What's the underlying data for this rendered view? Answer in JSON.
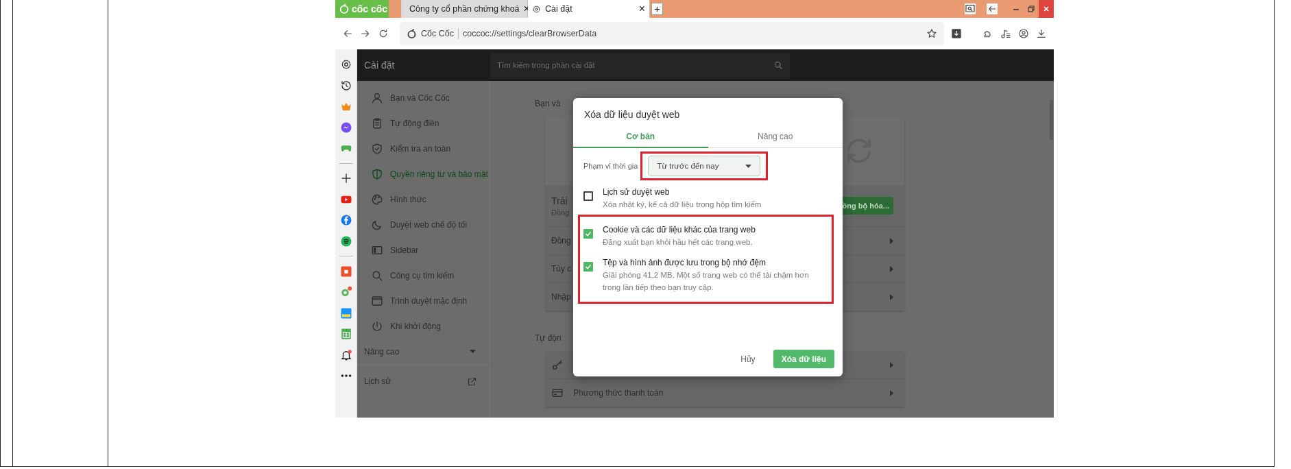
{
  "browser": {
    "tab_strip": {
      "logo": "cốc cốc",
      "new_tab": "+",
      "tabs": [
        {
          "title": "Công ty cổ phần chứng khoá",
          "close": "×",
          "selected": false
        },
        {
          "title": "Cài đặt",
          "close": "×",
          "selected": true
        }
      ]
    },
    "toolbar": {
      "site_name": "Cốc Cốc",
      "url": "coccoc://settings/clearBrowserData"
    },
    "settings": {
      "header_title": "Cài đặt",
      "search_placeholder": "Tìm kiếm trong phần cài đặt",
      "sidebar": {
        "items": [
          {
            "label": "Bạn và Cốc Cốc",
            "selected": false
          },
          {
            "label": "Tự động điền",
            "selected": false
          },
          {
            "label": "Kiểm tra an toàn",
            "selected": false
          },
          {
            "label": "Quyền riêng tư và bảo mật",
            "selected": true
          },
          {
            "label": "Hình thức",
            "selected": false
          },
          {
            "label": "Duyệt web chế độ tối",
            "selected": false
          },
          {
            "label": "Sidebar",
            "selected": false
          },
          {
            "label": "Công cụ tìm kiếm",
            "selected": false
          },
          {
            "label": "Trình duyệt mặc định",
            "selected": false
          },
          {
            "label": "Khi khởi động",
            "selected": false
          }
        ],
        "advanced": "Nâng cao",
        "history": "Lịch sử"
      },
      "main": {
        "section_heading": "Bạn và",
        "sync_card": {
          "title": "Trải",
          "subtitle": "Đồng",
          "button": "ồng bộ hóa...",
          "rows": [
            "Đồng",
            "Tùy c",
            "Nhập"
          ]
        },
        "autofill_heading": "Tự độn",
        "autofill_rows": [
          {
            "kind": "key"
          },
          {
            "kind": "card",
            "label": "Phương thức thanh toán"
          }
        ]
      }
    },
    "dialog": {
      "title": "Xóa dữ liệu duyệt web",
      "tabs": [
        {
          "label": "Cơ bản",
          "selected": true
        },
        {
          "label": "Nâng cao",
          "selected": false
        }
      ],
      "time_range": {
        "label": "Phạm vi thời gia",
        "value": "Từ trước đến nay",
        "highlighted": true
      },
      "options": [
        {
          "title": "Lịch sử duyệt web",
          "description": "Xóa nhật ký, kể cả dữ liệu trong hộp tìm kiếm",
          "checked": false,
          "highlighted": false
        },
        {
          "title": "Cookie và các dữ liệu khác của trang web",
          "description": "Đăng xuất bạn khỏi hầu hết các trang web.",
          "checked": true,
          "highlighted": true
        },
        {
          "title": "Tệp và hình ảnh được lưu trong bộ nhớ đệm",
          "description": "Giải phóng 41,2 MB. Một số trang web có thể tải chậm hơn trong lần tiếp theo bạn truy cập.",
          "checked": true,
          "highlighted": true
        }
      ],
      "cancel": "Hủy",
      "confirm": "Xóa dữ liệu"
    }
  }
}
